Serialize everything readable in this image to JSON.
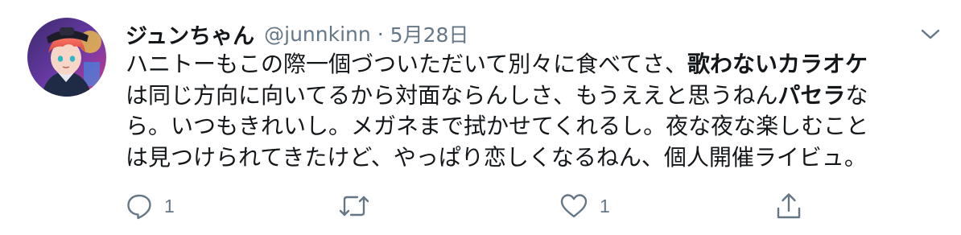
{
  "tweet": {
    "display_name": "ジュンちゃん",
    "handle": "@junnkinn",
    "separator": "·",
    "date": "5月28日",
    "text_segments": [
      "ハニトーもこの際一個づついただいて別々に食べてさ、",
      "歌わないカラオケ",
      "は同じ方向に向いてるから対面ならんしさ、もうええと思うねん",
      "パセラ",
      "なら。いつもきれいし。メガネまで拭かせてくれるし。夜な夜な楽しむこと",
      "は見つけられてきたけど、やっぱり恋しくなるねん、個人開催ライビュ。"
    ],
    "lines": {
      "l1_a": "ハニトーもこの際一個づついただいて別々に食べてさ、",
      "l1_b": "歌わないカラオケ",
      "l2_a": "は同じ方向に向いてるから対面ならんしさ、もうええと思うねん",
      "l2_b": "パセラ",
      "l2_c": "な",
      "l3": "ら。いつもきれいし。メガネまで拭かせてくれるし。夜な夜な楽しむこと",
      "l4": "は見つけられてきたけど、やっぱり恋しくなるねん、個人開催ライビュ。"
    },
    "actions": {
      "reply_count": "1",
      "retweet_count": "",
      "like_count": "1"
    }
  },
  "icons": {
    "reply": "reply-icon",
    "retweet": "retweet-icon",
    "like": "heart-icon",
    "share": "share-icon",
    "menu": "chevron-down-icon"
  },
  "colors": {
    "text": "#14171a",
    "secondary": "#657786",
    "background": "#ffffff"
  }
}
